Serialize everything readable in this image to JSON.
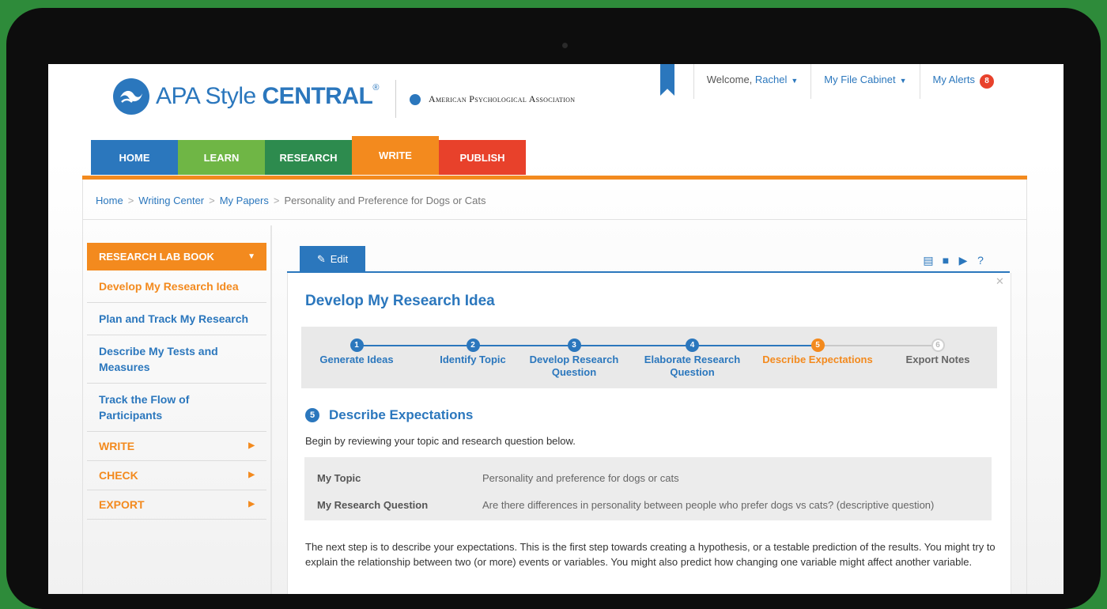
{
  "brand": {
    "name_light": "APA Style ",
    "name_bold": "CENTRAL",
    "reg": "®",
    "association": "American Psychological Association"
  },
  "topnav": {
    "welcome_prefix": "Welcome, ",
    "user_name": "Rachel",
    "file_cabinet": "My File Cabinet",
    "alerts_label": "My Alerts",
    "alerts_count": "8"
  },
  "mainnav": [
    {
      "label": "HOME",
      "color": "#2b77bd"
    },
    {
      "label": "LEARN",
      "color": "#6fb645"
    },
    {
      "label": "RESEARCH",
      "color": "#2d8b4e"
    },
    {
      "label": "WRITE",
      "color": "#f38a1e"
    },
    {
      "label": "PUBLISH",
      "color": "#e8412b"
    }
  ],
  "breadcrumb": [
    "Home",
    "Writing Center",
    "My Papers",
    "Personality and Preference for Dogs or Cats"
  ],
  "sidebar": {
    "header": "RESEARCH LAB BOOK",
    "items": [
      "Develop My Research Idea",
      "Plan and Track My Research",
      "Describe My Tests and Measures",
      "Track the Flow of Participants"
    ],
    "sections": [
      "WRITE",
      "CHECK",
      "EXPORT"
    ]
  },
  "content": {
    "edit_tab": "Edit",
    "title": "Develop My Research Idea",
    "steps": [
      {
        "num": "1",
        "label": "Generate Ideas"
      },
      {
        "num": "2",
        "label": "Identify Topic"
      },
      {
        "num": "3",
        "label": "Develop Research Question"
      },
      {
        "num": "4",
        "label": "Elaborate Research Question"
      },
      {
        "num": "5",
        "label": "Describe Expectations"
      },
      {
        "num": "6",
        "label": "Export Notes"
      }
    ],
    "section_num": "5",
    "section_title": "Describe Expectations",
    "intro": "Begin by reviewing your topic and research question below.",
    "topic_label": "My Topic",
    "topic_value": "Personality and preference for dogs or cats",
    "question_label": "My Research Question",
    "question_value": "Are there differences in personality between people who prefer dogs vs cats? (descriptive question)",
    "body": "The next step is to describe your expectations. This is the first step towards creating a hypothesis, or a testable prediction of the results. You might try to explain the relationship between two (or more) events or variables. You might also predict how changing one variable might affect another variable."
  }
}
